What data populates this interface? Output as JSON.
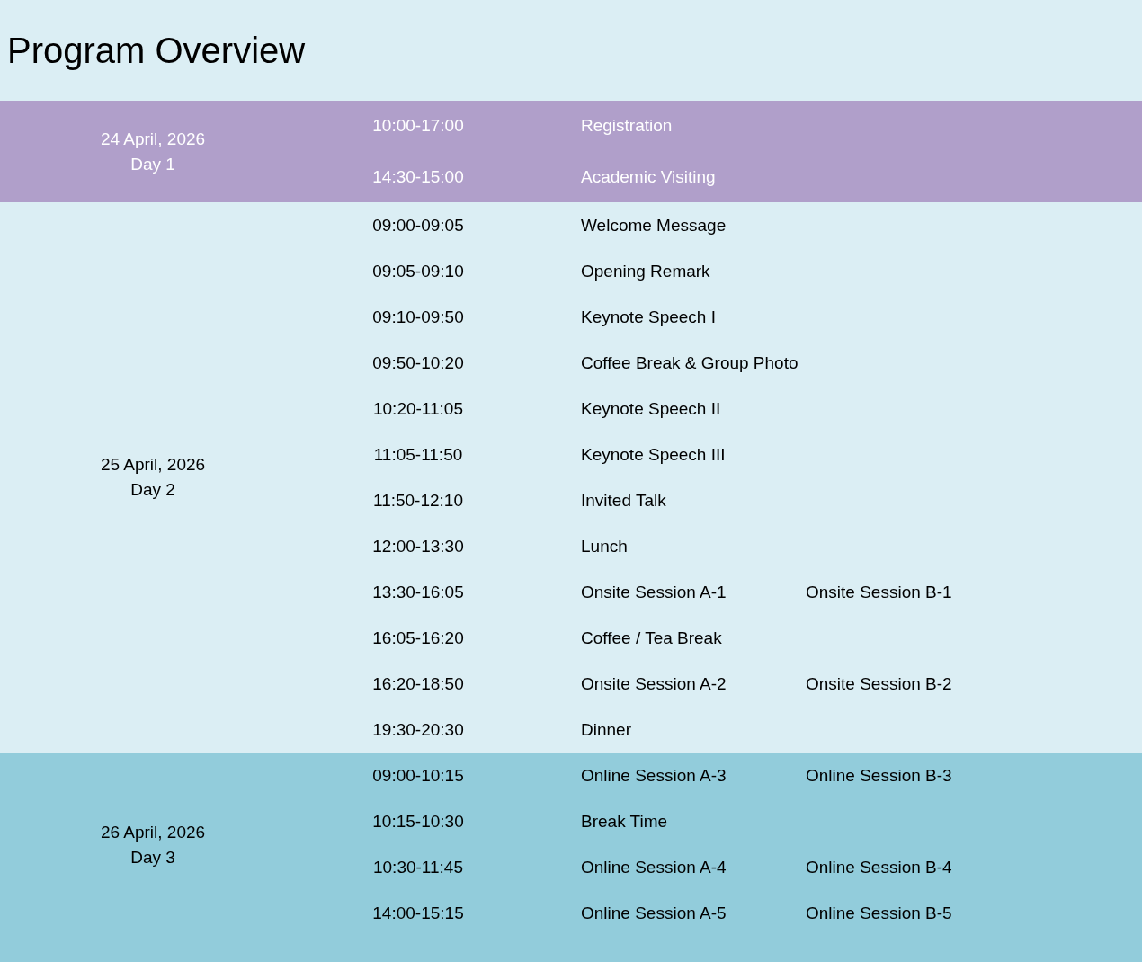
{
  "title": "Program Overview",
  "days": [
    {
      "date": "24 April, 2026",
      "day": "Day 1",
      "color": "#b09fca",
      "sessions": [
        {
          "time": "10:00-17:00",
          "event": "Registration"
        },
        {
          "time": "14:30-15:00",
          "event": "Academic Visiting"
        }
      ]
    },
    {
      "date": "25 April, 2026",
      "day": "Day 2",
      "color": "#dbeef4",
      "sessions": [
        {
          "time": "09:00-09:05",
          "event": "Welcome Message"
        },
        {
          "time": "09:05-09:10",
          "event": "Opening Remark"
        },
        {
          "time": "09:10-09:50",
          "event": "Keynote Speech I"
        },
        {
          "time": "09:50-10:20",
          "event": "Coffee Break & Group Photo"
        },
        {
          "time": "10:20-11:05",
          "event": "Keynote Speech II"
        },
        {
          "time": "11:05-11:50",
          "event": "Keynote Speech III"
        },
        {
          "time": "11:50-12:10",
          "event": "Invited Talk"
        },
        {
          "time": "12:00-13:30",
          "event": "Lunch"
        },
        {
          "time": "13:30-16:05",
          "event": "Onsite Session A-1",
          "parallel": "Onsite Session B-1"
        },
        {
          "time": "16:05-16:20",
          "event": "Coffee / Tea Break"
        },
        {
          "time": "16:20-18:50",
          "event": "Onsite Session A-2",
          "parallel": "Onsite Session B-2"
        },
        {
          "time": "19:30-20:30",
          "event": "Dinner"
        }
      ]
    },
    {
      "date": "26 April, 2026",
      "day": "Day 3",
      "color": "#92ccdb",
      "sessions": [
        {
          "time": "09:00-10:15",
          "event": "Online Session A-3",
          "parallel": "Online Session B-3"
        },
        {
          "time": "10:15-10:30",
          "event": "Break Time"
        },
        {
          "time": "10:30-11:45",
          "event": "Online Session A-4",
          "parallel": "Online Session B-4"
        },
        {
          "time": "14:00-15:15",
          "event": "Online Session A-5",
          "parallel": "Online Session B-5"
        }
      ]
    }
  ]
}
